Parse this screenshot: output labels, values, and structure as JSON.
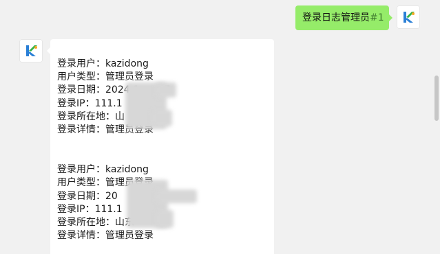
{
  "sent_message": {
    "text": "登录日志管理员",
    "mention": "#1"
  },
  "log_records": [
    {
      "lines": [
        "登录用户：kazidong",
        "用户类型：管理员登录",
        "登录日期：2024-1  ...  :47",
        "登录IP：111.1",
        "登录所在地：山",
        "登录详情：管理员登录"
      ]
    },
    {
      "lines": [
        "登录用户：kazidong",
        "用户类型：管理员登录",
        "登录日期：20",
        "登录IP：111.1",
        "登录所在地：山东",
        "登录详情：管理员登录"
      ]
    }
  ],
  "icons": {
    "sender_avatar": "avatar-logo-icon",
    "bot_avatar": "avatar-logo-icon"
  },
  "colors": {
    "sent_bubble": "#95ec69",
    "received_bubble": "#ffffff",
    "background": "#f1f1f1"
  }
}
